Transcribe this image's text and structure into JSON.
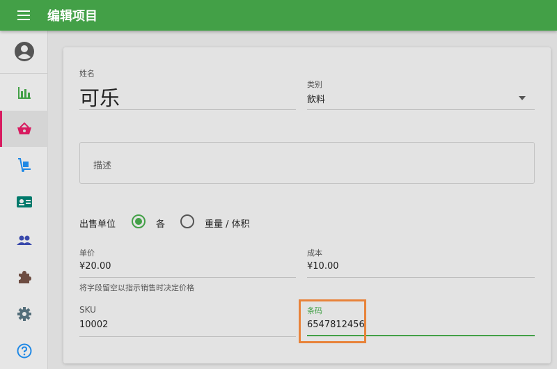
{
  "header": {
    "title": "编辑项目"
  },
  "sidebar": {
    "items": [
      {
        "icon": "account-circle-icon",
        "color": "#555555"
      },
      {
        "icon": "bar-chart-icon",
        "color": "#43a047"
      },
      {
        "icon": "basket-icon",
        "color": "#d81b60",
        "active": true
      },
      {
        "icon": "hand-truck-icon",
        "color": "#1e88e5"
      },
      {
        "icon": "id-card-icon",
        "color": "#00796b"
      },
      {
        "icon": "people-icon",
        "color": "#3949ab"
      },
      {
        "icon": "puzzle-icon",
        "color": "#6d4c41"
      },
      {
        "icon": "gear-icon",
        "color": "#546e7a"
      },
      {
        "icon": "help-icon",
        "color": "#1e88e5"
      }
    ]
  },
  "form": {
    "name": {
      "label": "姓名",
      "value": "可乐"
    },
    "category": {
      "label": "类别",
      "value": "飲料"
    },
    "description": {
      "placeholder": "描述"
    },
    "sell_unit": {
      "label": "出售单位",
      "options": [
        "各",
        "重量 / 体积"
      ],
      "selected": "各"
    },
    "price": {
      "label": "单价",
      "value": "¥20.00",
      "hint": "将字段留空以指示销售时决定价格"
    },
    "cost": {
      "label": "成本",
      "value": "¥10.00"
    },
    "sku": {
      "label": "SKU",
      "value": "10002"
    },
    "barcode": {
      "label": "条码",
      "value": "6547812456"
    }
  },
  "colors": {
    "accent": "#43a047",
    "highlight": "#e8833a",
    "active_marker": "#d81b60"
  }
}
